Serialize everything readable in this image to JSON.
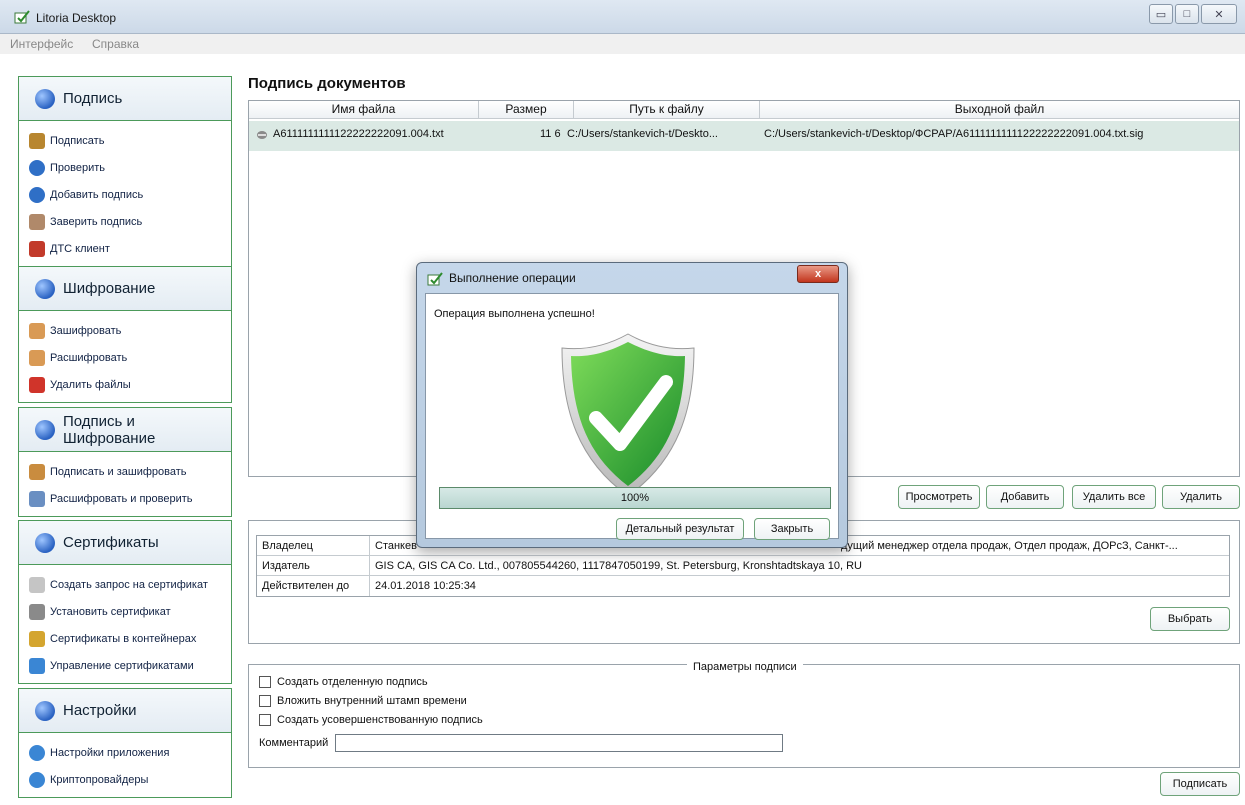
{
  "window": {
    "title": "Litoria Desktop",
    "minimize_glyph": "▭",
    "maximize_glyph": "□",
    "close_glyph": "✕"
  },
  "menu": [
    "Интерфейс",
    "Справка"
  ],
  "sidebar": {
    "sections": [
      {
        "title": "Подпись",
        "icon": "signature-globe-icon",
        "items": [
          {
            "label": "Подписать",
            "icon": "pen-icon",
            "color": "#b8862f"
          },
          {
            "label": "Проверить",
            "icon": "verify-icon",
            "color": "#2f6fc6"
          },
          {
            "label": "Добавить подпись",
            "icon": "add-signature-icon",
            "color": "#2f6fc6"
          },
          {
            "label": "Заверить подпись",
            "icon": "certify-signature-icon",
            "color": "#b0896a"
          },
          {
            "label": "ДТС клиент",
            "icon": "dts-client-icon",
            "color": "#c23a2a"
          }
        ]
      },
      {
        "title": "Шифрование",
        "icon": "encryption-shield-icon",
        "items": [
          {
            "label": "Зашифровать",
            "icon": "encrypt-icon",
            "color": "#d99a55"
          },
          {
            "label": "Расшифровать",
            "icon": "decrypt-icon",
            "color": "#d99a55"
          },
          {
            "label": "Удалить файлы",
            "icon": "delete-files-icon",
            "color": "#d0342a"
          }
        ]
      },
      {
        "title": "Подпись и Шифрование",
        "icon": "sign-encrypt-icon",
        "items": [
          {
            "label": "Подписать и зашифровать",
            "icon": "sign-and-encrypt-icon",
            "color": "#c98c3f"
          },
          {
            "label": "Расшифровать и проверить",
            "icon": "decrypt-and-verify-icon",
            "color": "#6a8fc2"
          }
        ]
      },
      {
        "title": "Сертификаты",
        "icon": "certificates-icon",
        "items": [
          {
            "label": "Создать запрос на сертификат",
            "icon": "certificate-request-icon",
            "color": "#c5c5c5"
          },
          {
            "label": "Установить сертификат",
            "icon": "install-certificate-icon",
            "color": "#8a8a8a"
          },
          {
            "label": "Сертификаты в контейнерах",
            "icon": "container-certificates-icon",
            "color": "#d4a52f"
          },
          {
            "label": "Управление сертификатами",
            "icon": "manage-certificates-icon",
            "color": "#3a86d4"
          }
        ]
      },
      {
        "title": "Настройки",
        "icon": "settings-icon",
        "items": [
          {
            "label": "Настройки приложения",
            "icon": "app-settings-gear-icon",
            "color": "#3a86d4"
          },
          {
            "label": "Криптопровайдеры",
            "icon": "crypto-providers-icon",
            "color": "#3a86d4"
          }
        ]
      }
    ]
  },
  "main": {
    "title": "Подпись документов",
    "table": {
      "columns": [
        "Имя файла",
        "Размер",
        "Путь к файлу",
        "Выходной файл"
      ],
      "rows": [
        {
          "name": "A6111111111122222222091.004.txt",
          "size": "11 6",
          "path": "C:/Users/stankevich-t/Deskto...",
          "output": "C:/Users/stankevich-t/Desktop/ФСРАР/A6111111111122222222091.004.txt.sig"
        }
      ]
    },
    "buttons": {
      "view": "Просмотреть",
      "add": "Добавить",
      "delete_all": "Удалить все",
      "delete": "Удалить",
      "choose": "Выбрать",
      "sign": "Подписать"
    },
    "certificate": {
      "owner_label": "Владелец",
      "owner_visible_start": "Станкев",
      "owner_visible_end": "дущий менеджер отдела продаж, Отдел продаж, ДОРсЗ, Санкт-...",
      "issuer_label": "Издатель",
      "issuer": "GIS CA, GIS CA Co. Ltd., 007805544260, 1117847050199, St. Petersburg, Kronshtadtskaya 10, RU",
      "valid_label": "Действителен до",
      "valid": "24.01.2018 10:25:34"
    },
    "params": {
      "legend": "Параметры подписи",
      "options": [
        {
          "label": "Создать отделенную подпись",
          "checked": false
        },
        {
          "label": "Вложить внутренний штамп времени",
          "checked": false
        },
        {
          "label": "Создать усовершенствованную подпись",
          "checked": false
        }
      ],
      "comment_label": "Комментарий",
      "comment_value": ""
    }
  },
  "dialog": {
    "title": "Выполнение операции",
    "close_glyph": "x",
    "message": "Операция выполнена успешно!",
    "progress_text": "100%",
    "progress_value": 1.0,
    "detail_button": "Детальный результат",
    "close_button": "Закрыть",
    "shield_color": "#2fae3a"
  }
}
